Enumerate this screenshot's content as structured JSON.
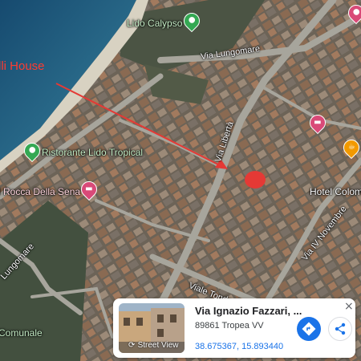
{
  "map": {
    "labels": {
      "house": "lli House",
      "lido_calypso": "Lido Calypso",
      "via_lungomare": "Via Lungomare",
      "ristorante": "Ristorante Lido Tropical",
      "via_liberta": "Via Libertà",
      "rocca": "l Rocca Della Sena",
      "hotel": "Hotel Colom",
      "lungomare_left": "Lungomare",
      "via_iv_novembre": "Via IV Novembre",
      "viale_tondo": "Viale Tondo",
      "comunale": "Comunale"
    },
    "colors": {
      "arrow": "#e53935",
      "marker": "#e53935",
      "house_label": "#ff3b30",
      "green_pin": "#34a853",
      "pink_pin": "#d94a78",
      "orange_pin": "#f29900"
    },
    "icons": [
      "landmark-pin-icon",
      "hotel-pin-icon",
      "cafe-pin-icon",
      "restaurant-pin-icon"
    ]
  },
  "card": {
    "title": "Via Ignazio Fazzari, ...",
    "subtitle": "89861 Tropea VV",
    "coords": "38.675367, 15.893440",
    "street_view_label": "Street View",
    "close": "×"
  }
}
